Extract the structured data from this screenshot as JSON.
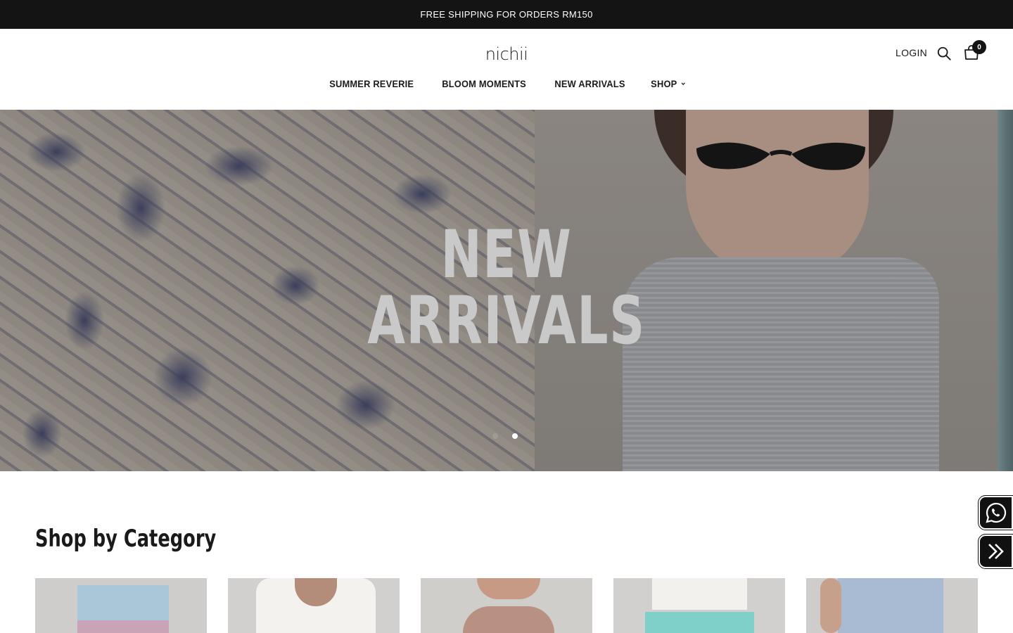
{
  "announcement": "FREE SHIPPING FOR ORDERS RM150",
  "header": {
    "logo": "nichii",
    "login_label": "LOGIN",
    "cart_count": "0",
    "icons": [
      "search-icon",
      "bag-icon"
    ]
  },
  "nav": {
    "items": [
      {
        "label": "SUMMER REVERIE"
      },
      {
        "label": "BLOOM MOMENTS"
      },
      {
        "label": "NEW ARRIVALS"
      },
      {
        "label": "SHOP",
        "has_dropdown": true
      }
    ]
  },
  "hero": {
    "title_line1": "NEW",
    "title_line2": "ARRIVALS",
    "slides": 2,
    "active_slide": 2
  },
  "category_section": {
    "title": "Shop by Category",
    "card_count": 5
  },
  "floating": {
    "icons": [
      "whatsapp-icon",
      "double-chevron-right-icon"
    ]
  },
  "colors": {
    "announcement_bg": "#141414",
    "text": "#1a1a1a",
    "page_bg": "#ffffff"
  }
}
